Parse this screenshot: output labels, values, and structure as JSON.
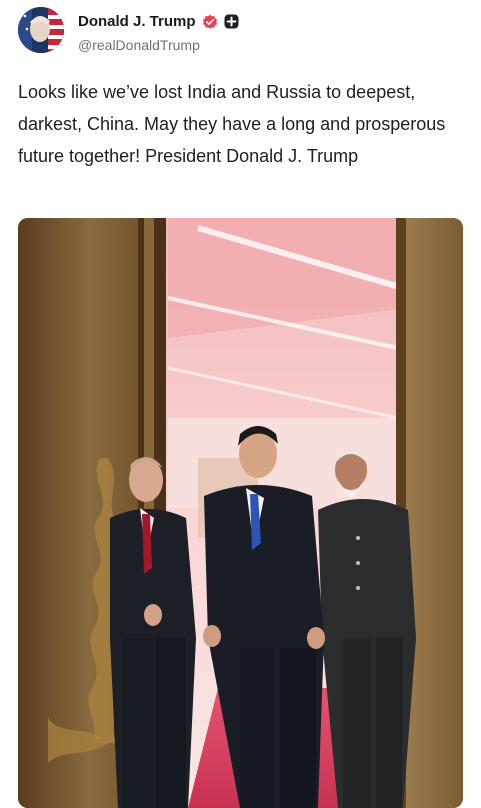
{
  "author": {
    "display_name": "Donald J. Trump",
    "handle": "@realDonaldTrump",
    "verified_icon": "verified-badge-icon",
    "extra_badge_icon": "plus-badge-icon"
  },
  "post": {
    "text": "Looks like we’ve lost India and Russia to deepest, darkest, China. May they have a long and prosperous future together! President Donald J. Trump"
  },
  "media": {
    "type": "photo",
    "accent_color": "#e03a5b"
  },
  "colors": {
    "verified": "#e8414f",
    "text": "#1f1f1f",
    "muted": "#6b7280"
  }
}
